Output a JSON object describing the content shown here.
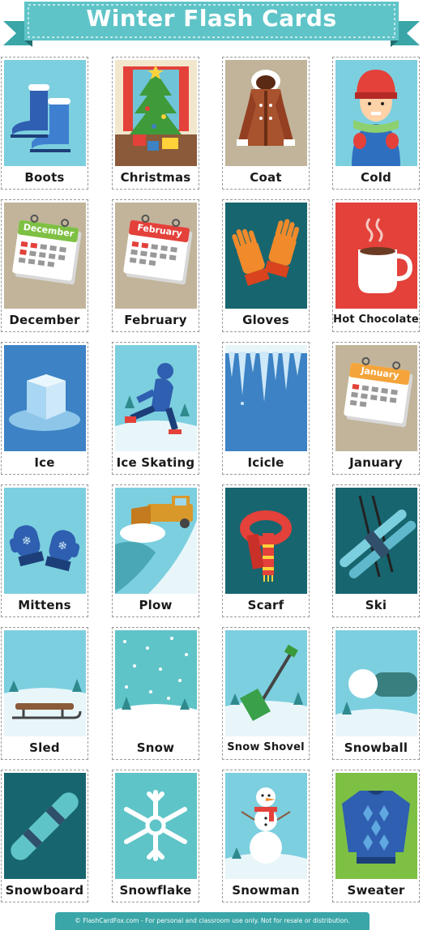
{
  "header": {
    "title": "Winter Flash Cards"
  },
  "cards": [
    {
      "label": "Boots",
      "icon": "boots-icon"
    },
    {
      "label": "Christmas",
      "icon": "christmas-tree-icon"
    },
    {
      "label": "Coat",
      "icon": "coat-icon"
    },
    {
      "label": "Cold",
      "icon": "cold-person-icon"
    },
    {
      "label": "December",
      "icon": "calendar-icon",
      "calendar_month": "December"
    },
    {
      "label": "February",
      "icon": "calendar-icon",
      "calendar_month": "February"
    },
    {
      "label": "Gloves",
      "icon": "gloves-icon"
    },
    {
      "label": "Hot Chocolate",
      "icon": "mug-icon"
    },
    {
      "label": "Ice",
      "icon": "ice-cube-icon"
    },
    {
      "label": "Ice Skating",
      "icon": "ice-skater-icon"
    },
    {
      "label": "Icicle",
      "icon": "icicle-icon"
    },
    {
      "label": "January",
      "icon": "calendar-icon",
      "calendar_month": "January"
    },
    {
      "label": "Mittens",
      "icon": "mittens-icon"
    },
    {
      "label": "Plow",
      "icon": "snow-plow-icon"
    },
    {
      "label": "Scarf",
      "icon": "scarf-icon"
    },
    {
      "label": "Ski",
      "icon": "skis-icon"
    },
    {
      "label": "Sled",
      "icon": "sled-icon"
    },
    {
      "label": "Snow",
      "icon": "snow-icon"
    },
    {
      "label": "Snow Shovel",
      "icon": "shovel-icon"
    },
    {
      "label": "Snowball",
      "icon": "snowball-icon"
    },
    {
      "label": "Snowboard",
      "icon": "snowboard-icon"
    },
    {
      "label": "Snowflake",
      "icon": "snowflake-icon"
    },
    {
      "label": "Snowman",
      "icon": "snowman-icon"
    },
    {
      "label": "Sweater",
      "icon": "sweater-icon"
    }
  ],
  "footer": {
    "text": "© FlashCardFox.com - For personal and classroom use only. Not for resale or distribution."
  },
  "colors": {
    "banner": "#5fc4c8",
    "footer": "#3aa6a8",
    "light_blue": "#7ccfdf",
    "dark_teal": "#17656f",
    "tan": "#c1b49a",
    "red": "#e3413a",
    "blue": "#3c82c4",
    "green": "#7ec043"
  }
}
